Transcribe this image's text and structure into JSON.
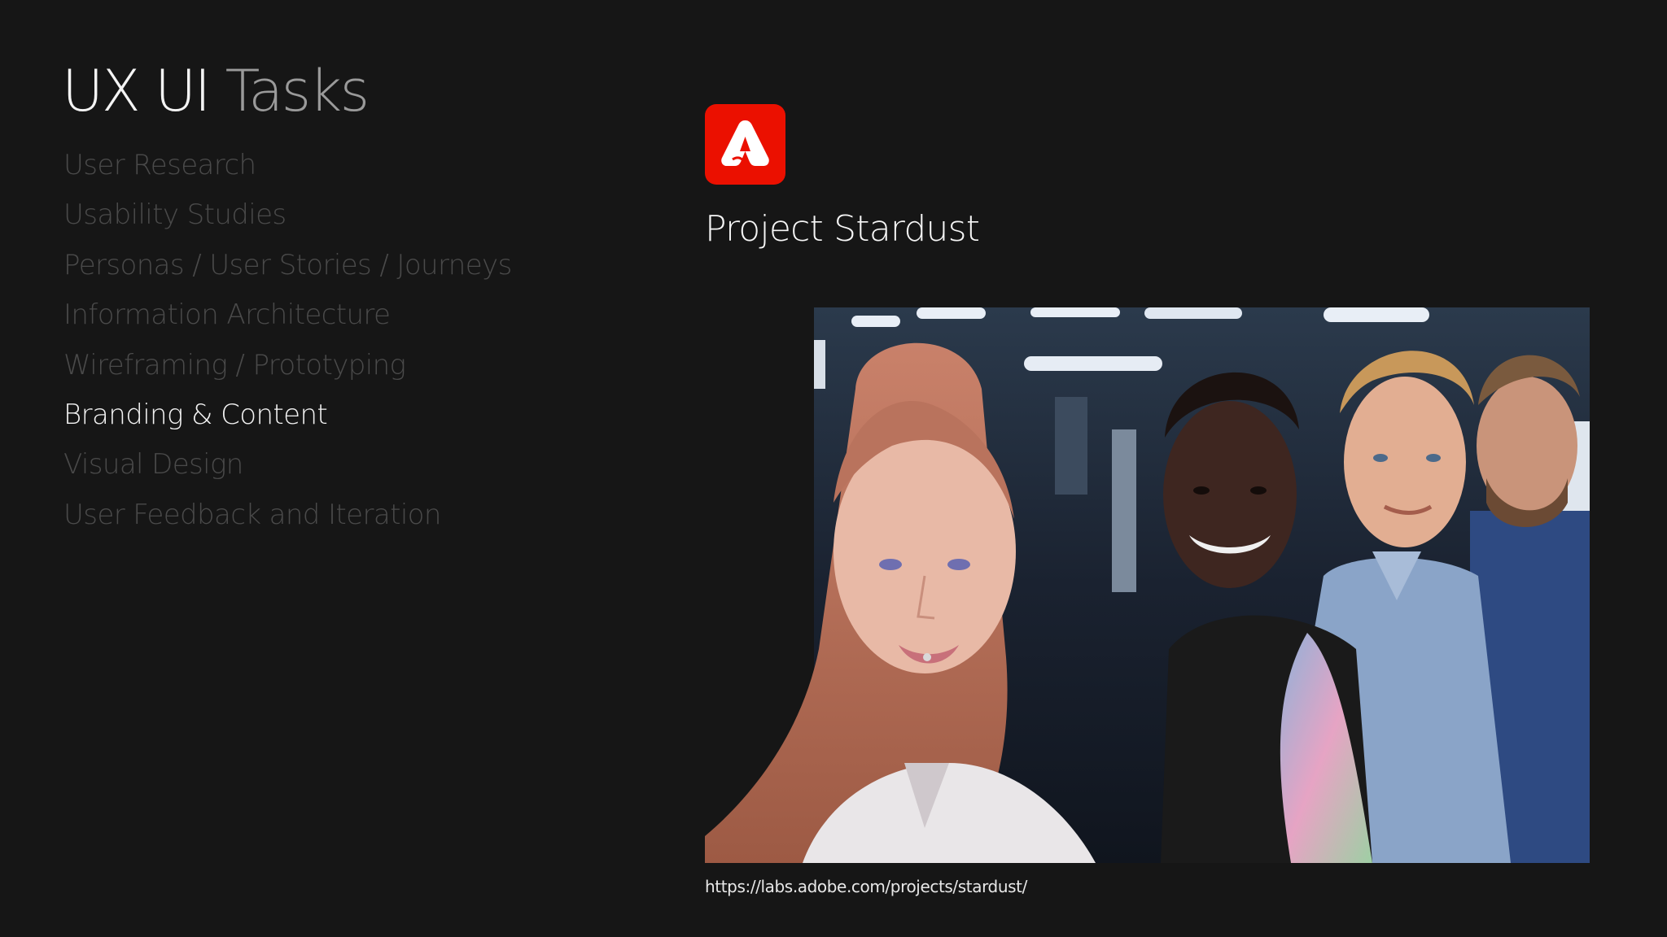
{
  "heading": {
    "part1": "UX UI",
    "part2": "Tasks"
  },
  "tasks": [
    {
      "label": "User Research",
      "active": false
    },
    {
      "label": "Usability Studies",
      "active": false
    },
    {
      "label": "Personas / User Stories / Journeys",
      "active": false
    },
    {
      "label": "Information Architecture",
      "active": false
    },
    {
      "label": "Wireframing / Prototyping",
      "active": false
    },
    {
      "label": "Branding & Content",
      "active": true
    },
    {
      "label": "Visual Design",
      "active": false
    },
    {
      "label": "User Feedback and Iteration",
      "active": false
    }
  ],
  "project": {
    "logo_icon": "adobe-express-logo-icon",
    "title": "Project Stardust",
    "url": "https://labs.adobe.com/projects/stardust/",
    "image": "photo-of-four-people-smiling"
  },
  "colors": {
    "background": "#161616",
    "active_text": "#f2f2f2",
    "inactive_text": "#4a4a4a",
    "logo_red": "#eb1000"
  }
}
